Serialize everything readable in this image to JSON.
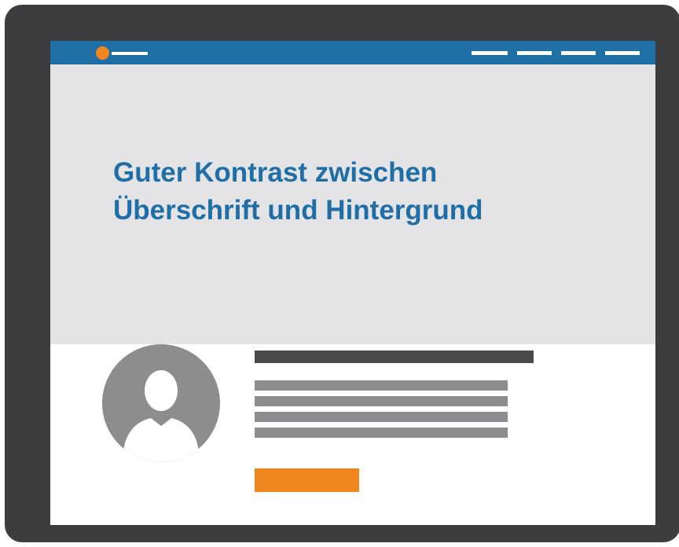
{
  "colors": {
    "device_frame": "#3d3d40",
    "header_bar": "#1f6ea6",
    "accent_orange": "#f0861e",
    "hero_background": "#e4e4e6",
    "headline_text": "#1f6ea6",
    "placeholder_dark": "#4a4a4c",
    "placeholder_mid": "#8d8d8f"
  },
  "header": {
    "logo_icon": "logo-dot-icon",
    "nav_items": [
      "",
      "",
      "",
      ""
    ]
  },
  "hero": {
    "headline_line1": "Guter Kontrast zwischen",
    "headline_line2": "Überschrift und Hintergrund"
  },
  "content": {
    "avatar_icon": "user-avatar-icon",
    "text_placeholder_lines": 4,
    "button_label": ""
  }
}
